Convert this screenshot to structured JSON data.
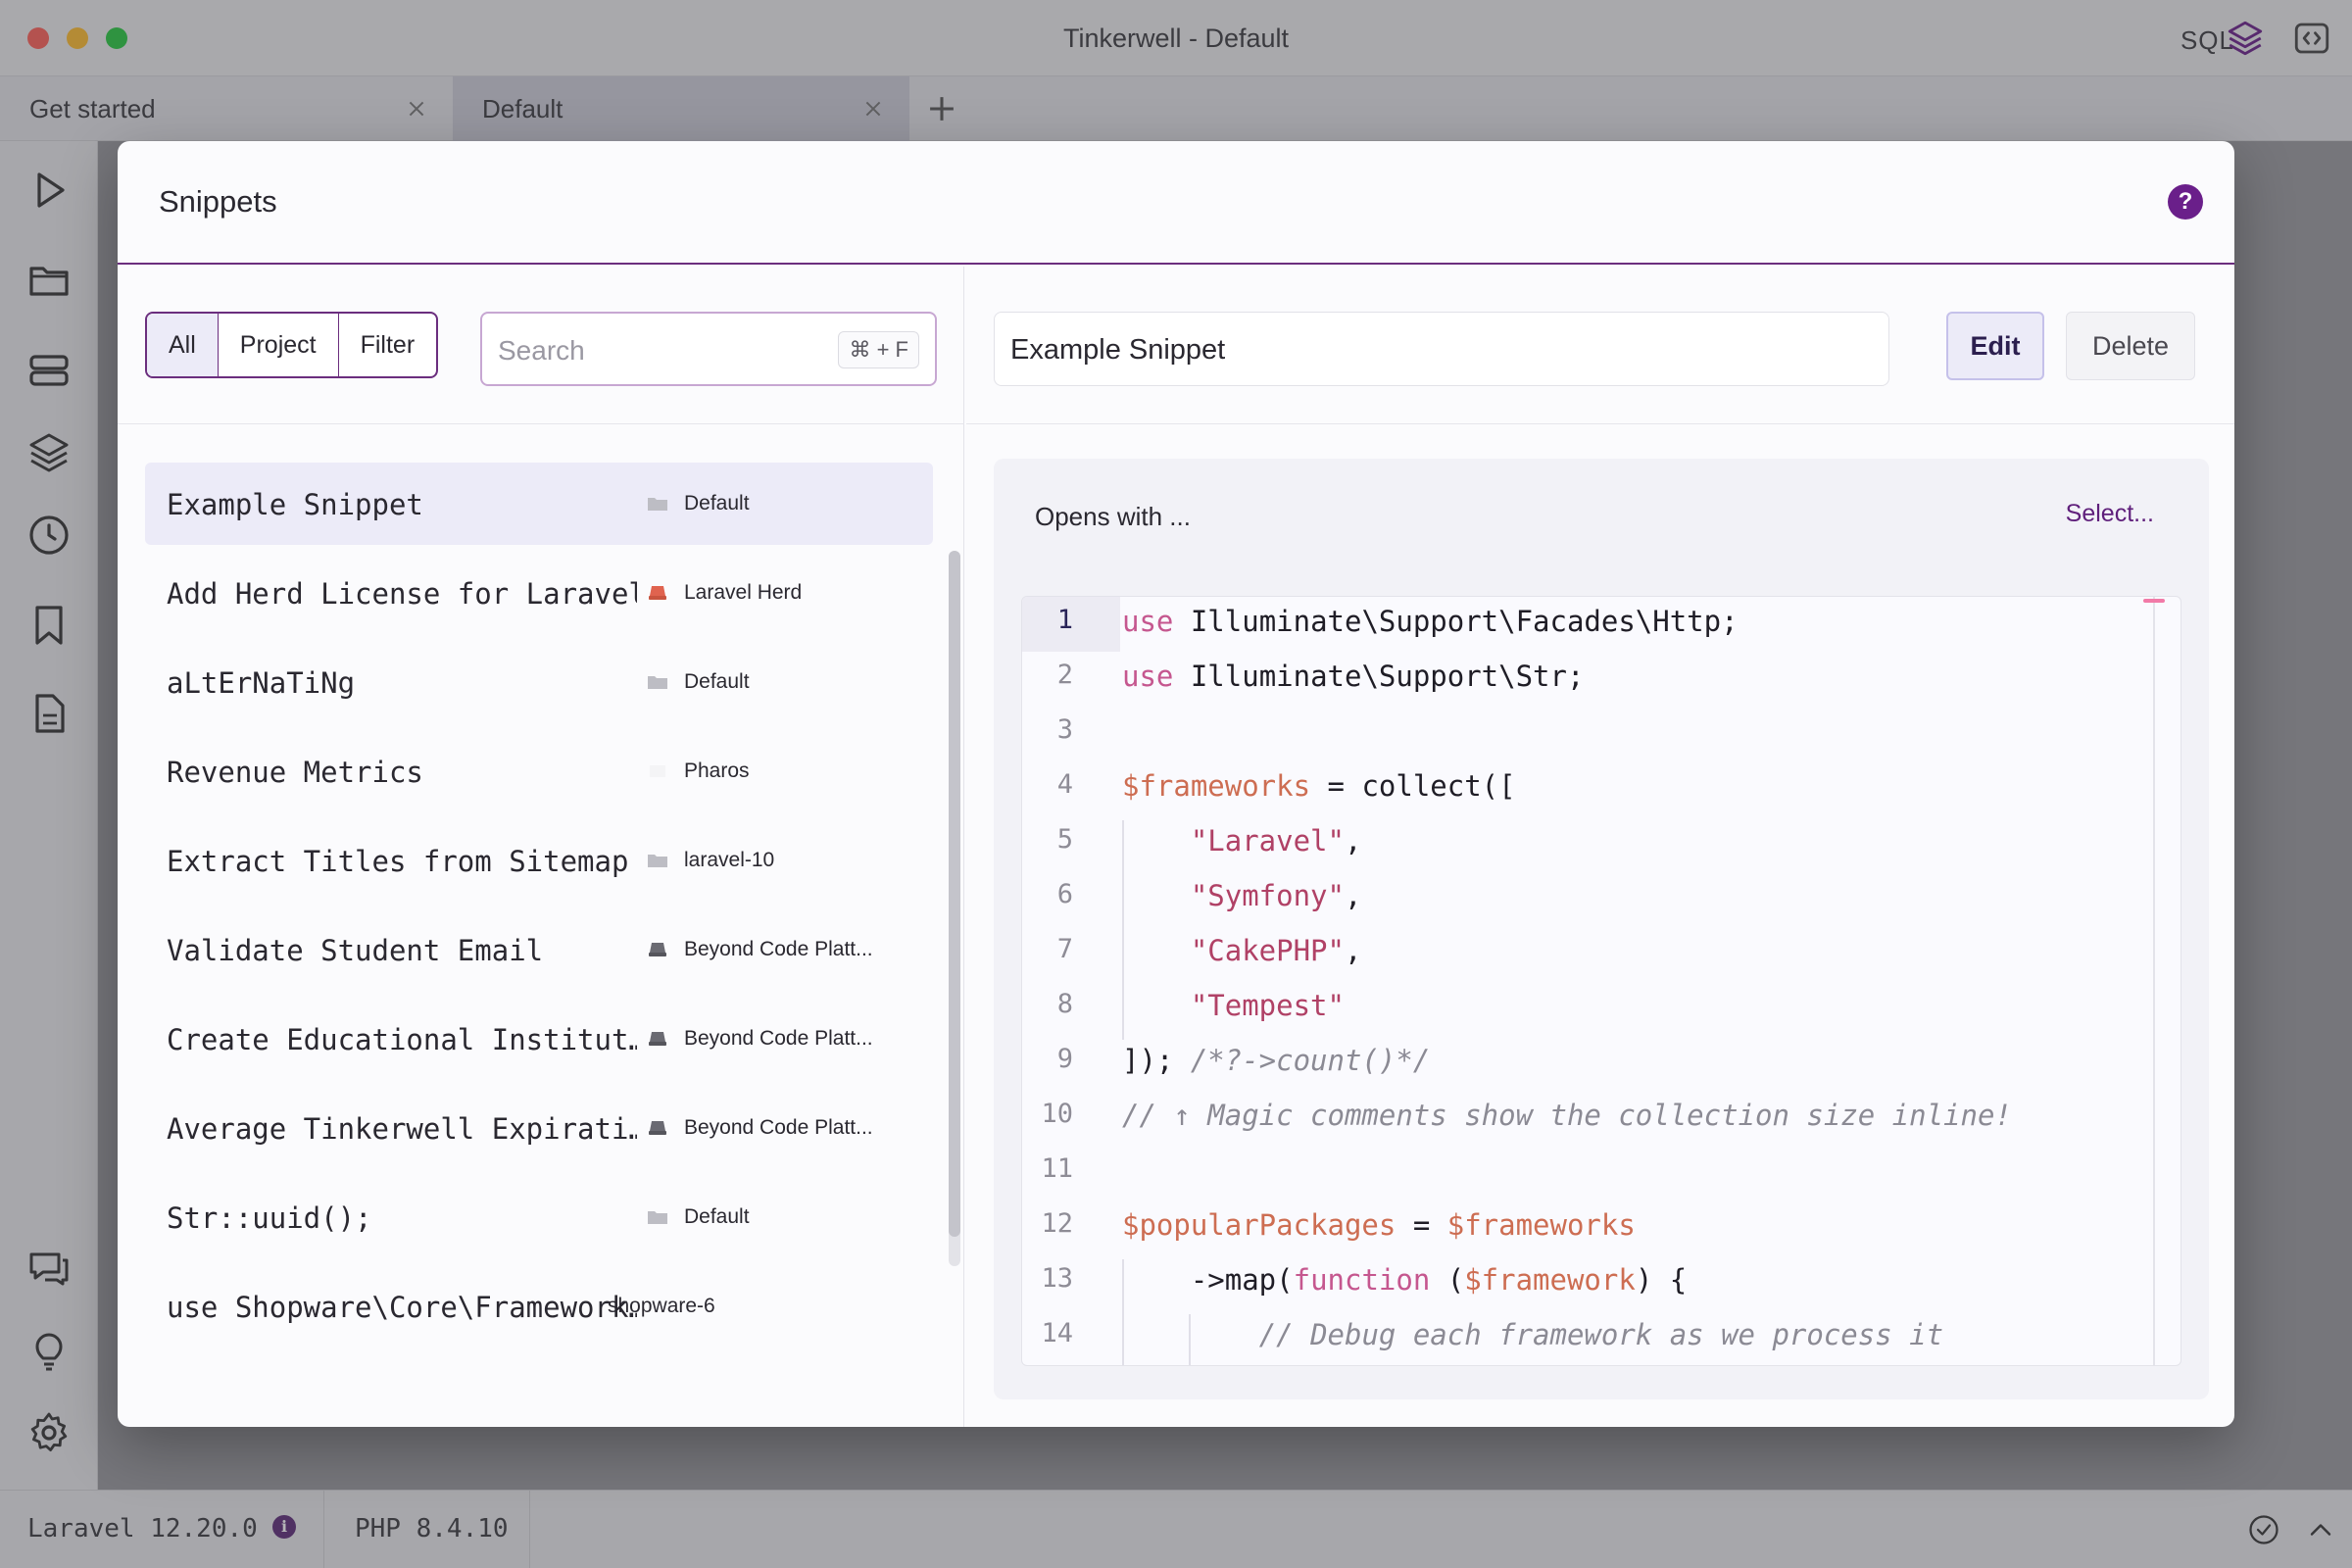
{
  "window": {
    "title": "Tinkerwell - Default",
    "sql_label": "SQL"
  },
  "tabs": [
    {
      "label": "Get started"
    },
    {
      "label": "Default"
    }
  ],
  "statusbar": {
    "laravel": "Laravel 12.20.0",
    "info_glyph": "i",
    "php": "PHP 8.4.10"
  },
  "modal": {
    "title": "Snippets",
    "help_glyph": "?",
    "filters": [
      "All",
      "Project",
      "Filter"
    ],
    "active_filter": "All",
    "search": {
      "placeholder": "Search",
      "shortcut": "⌘ + F"
    },
    "snippets": [
      {
        "name": "Example Snippet",
        "tag": "Default",
        "tag_icon": "folder-icon",
        "selected": true
      },
      {
        "name": "Add Herd License for Laravel",
        "tag": "Laravel Herd",
        "tag_icon": "herd-icon"
      },
      {
        "name": "aLtErNaTiNg",
        "tag": "Default",
        "tag_icon": "folder-icon"
      },
      {
        "name": "Revenue Metrics",
        "tag": "Pharos",
        "tag_icon": "blank-icon"
      },
      {
        "name": "Extract Titles from Sitemap",
        "tag": "laravel-10",
        "tag_icon": "folder-icon"
      },
      {
        "name": "Validate Student Email",
        "tag": "Beyond Code Platt...",
        "tag_icon": "server-icon"
      },
      {
        "name": "Create Educational Institut…",
        "tag": "Beyond Code Platt...",
        "tag_icon": "server-icon"
      },
      {
        "name": "Average Tinkerwell Expirati…",
        "tag": "Beyond Code Platt...",
        "tag_icon": "server-icon"
      },
      {
        "name": "Str::uuid();",
        "tag": "Default",
        "tag_icon": "folder-icon"
      },
      {
        "name": "use Shopware\\Core\\Framework…",
        "tag": "shopware-6",
        "tag_icon": "none"
      }
    ],
    "detail": {
      "name": "Example Snippet",
      "edit_label": "Edit",
      "delete_label": "Delete",
      "opens_with": "Opens with  ...",
      "select_label": "Select...",
      "code_lines": [
        {
          "n": "1",
          "html": "<span class=\"kw\">use</span> Illuminate\\Support\\Facades\\Http;"
        },
        {
          "n": "2",
          "html": "<span class=\"kw\">use</span> Illuminate\\Support\\Str;"
        },
        {
          "n": "3",
          "html": ""
        },
        {
          "n": "4",
          "html": "<span class=\"var\">$frameworks</span> = collect(["
        },
        {
          "n": "5",
          "html": "    <span class=\"str\">\"Laravel\"</span>,"
        },
        {
          "n": "6",
          "html": "    <span class=\"str\">\"Symfony\"</span>,"
        },
        {
          "n": "7",
          "html": "    <span class=\"str\">\"CakePHP\"</span>,"
        },
        {
          "n": "8",
          "html": "    <span class=\"str\">\"Tempest\"</span>"
        },
        {
          "n": "9",
          "html": "]); <span class=\"cmt\">/*?-&gt;count()*/</span>"
        },
        {
          "n": "10",
          "html": "<span class=\"cmt\">// ↑ Magic comments show the collection size inline!</span>"
        },
        {
          "n": "11",
          "html": ""
        },
        {
          "n": "12",
          "html": "<span class=\"var\">$popularPackages</span> = <span class=\"var\">$frameworks</span>"
        },
        {
          "n": "13",
          "html": "    -&gt;map(<span class=\"kw\">function</span> (<span class=\"var\">$framework</span>) {"
        },
        {
          "n": "14",
          "html": "        <span class=\"cmt\">// Debug each framework as we process it</span>"
        }
      ]
    }
  },
  "colors": {
    "accent": "#6b2e7e",
    "selection": "#ecebf8",
    "keyword": "#c5578f",
    "variable": "#cd6d52",
    "string": "#b04166"
  }
}
